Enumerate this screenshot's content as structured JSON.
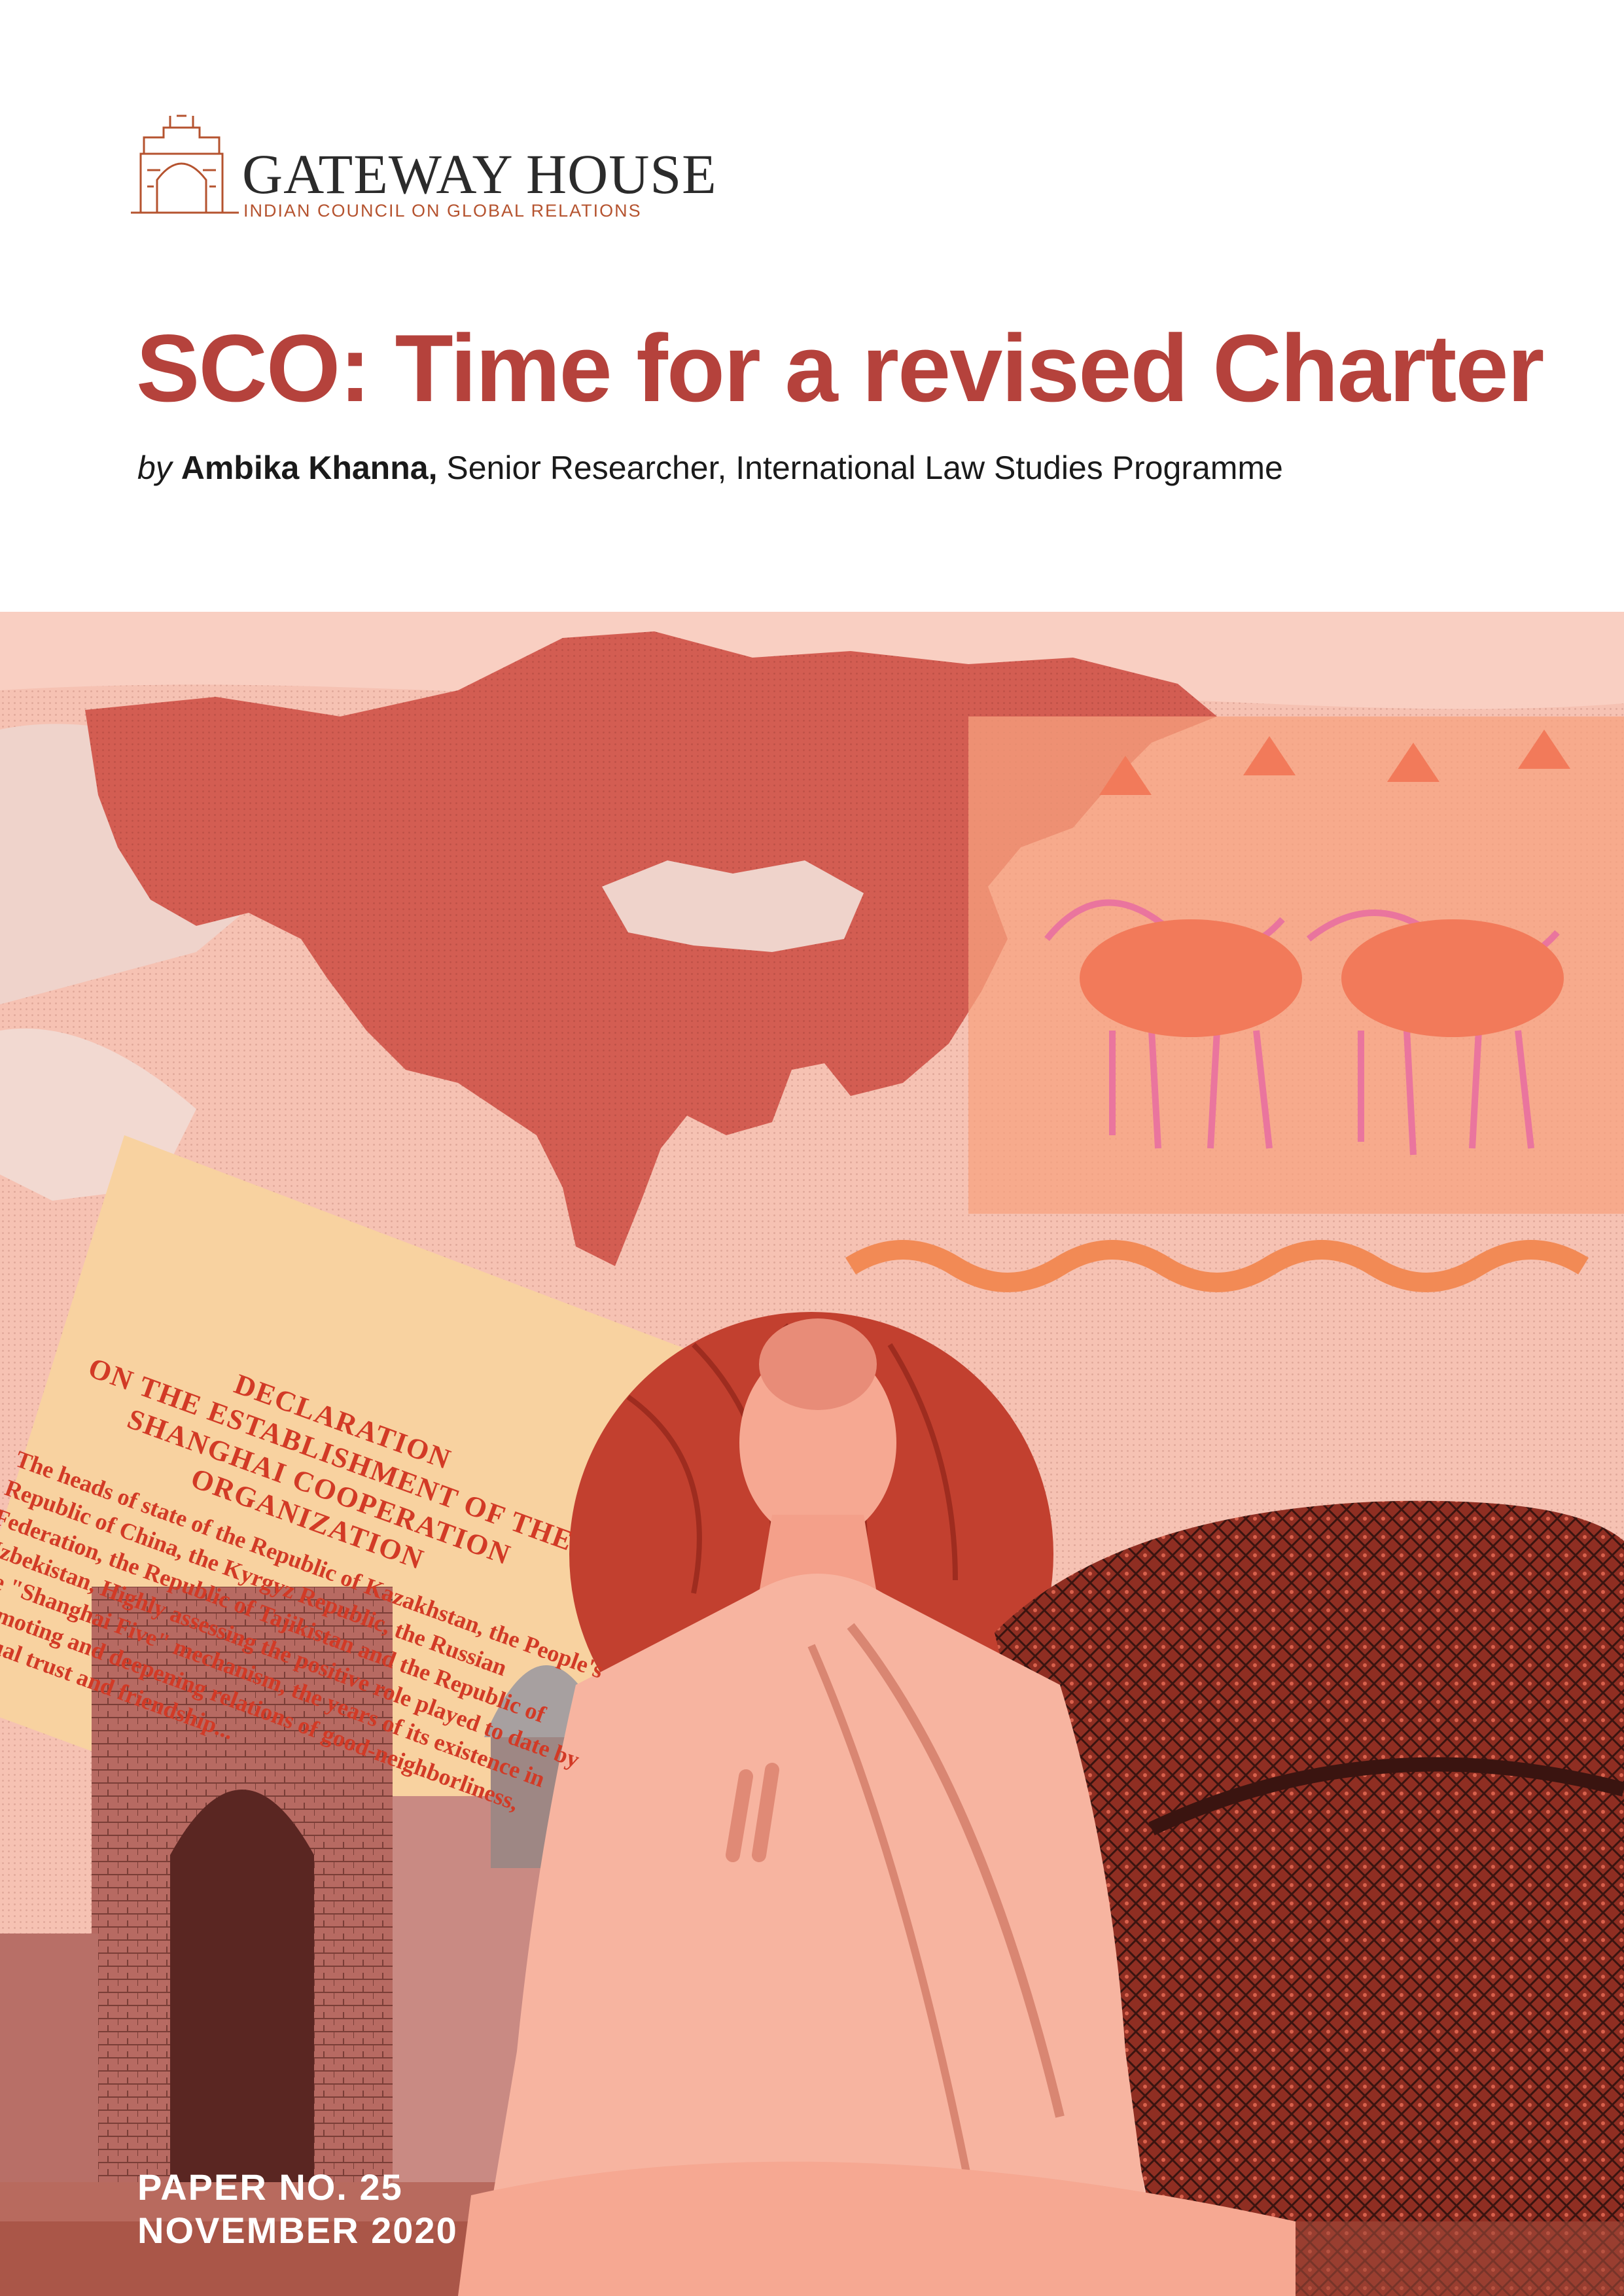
{
  "logo": {
    "name": "GATEWAY HOUSE",
    "subtitle": "INDIAN COUNCIL ON GLOBAL RELATIONS"
  },
  "title": "SCO: Time for a revised Charter",
  "byline": {
    "by": "by",
    "author": "Ambika Khanna,",
    "role": "Senior Researcher, International Law Studies Programme"
  },
  "declaration": {
    "title_line1": "DECLARATION",
    "title_line2": "ON THE ESTABLISHMENT OF THE",
    "title_line3": "SHANGHAI COOPERATION ORGANIZATION",
    "body": "The heads of state of the Republic of Kazakhstan, the People's Republic of China, the Kyrgyz Republic, the Russian Federation, the Republic of Tajikistan and the Republic of Uzbekistan, Highly assessing the positive role played to date by the \"Shanghai Five\" mechanism, the years of its existence in promoting and deepening relations of good-neighborliness, mutual trust and friendship..."
  },
  "paper_number": "PAPER NO. 25",
  "paper_date": "NOVEMBER 2020",
  "colors": {
    "title": "#b5423c",
    "logo_accent": "#b5532f",
    "collage_base": "#f4b9a8",
    "map": "#d35d52"
  }
}
